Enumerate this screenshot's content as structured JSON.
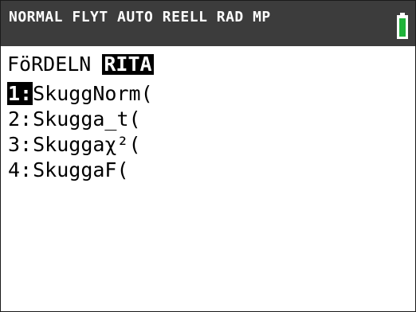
{
  "status_bar": {
    "text": "NORMAL FLYT AUTO REELL RAD MP",
    "battery_color": "#1fb33a",
    "icon": "battery-icon"
  },
  "menu": {
    "tabs": [
      {
        "label": "FöRDELN",
        "active": false
      },
      {
        "label": "RITA",
        "active": true
      }
    ],
    "items": [
      {
        "num": "1:",
        "label": "SkuggNorm(",
        "selected": true
      },
      {
        "num": "2:",
        "label": "Skugga_t(",
        "selected": false
      },
      {
        "num": "3:",
        "label": "Skuggaχ²(",
        "selected": false
      },
      {
        "num": "4:",
        "label": "SkuggaF(",
        "selected": false
      }
    ]
  }
}
